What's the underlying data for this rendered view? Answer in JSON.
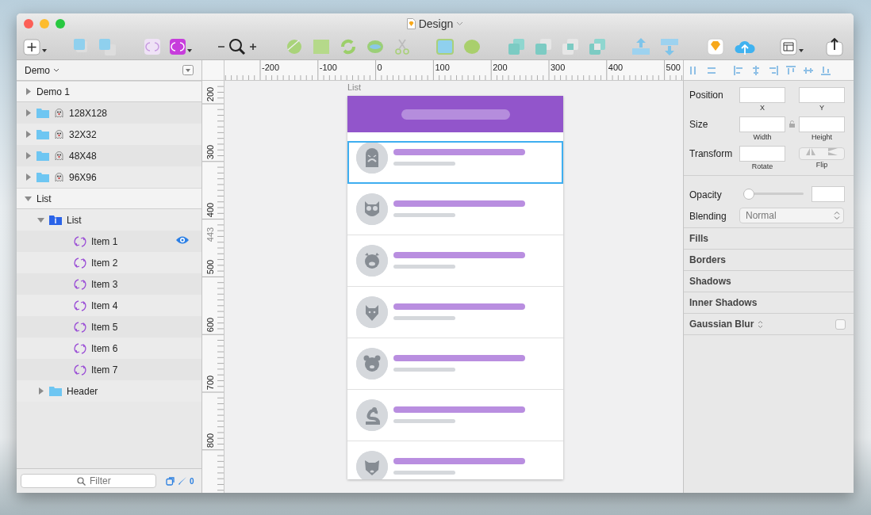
{
  "window": {
    "title": "Design"
  },
  "layers_panel": {
    "page": "Demo",
    "layers": [
      {
        "label": "Demo 1",
        "kind": "artboard",
        "expanded": false
      },
      {
        "label": "128X128",
        "kind": "symbol-folder",
        "expanded": false
      },
      {
        "label": "32X32",
        "kind": "symbol-folder",
        "expanded": false
      },
      {
        "label": "48X48",
        "kind": "symbol-folder",
        "expanded": false
      },
      {
        "label": "96X96",
        "kind": "symbol-folder",
        "expanded": false
      },
      {
        "label": "List",
        "kind": "artboard",
        "expanded": true,
        "children": [
          {
            "label": "List",
            "kind": "group",
            "expanded": true,
            "children": [
              {
                "label": "Item 1",
                "kind": "symbol",
                "hovered": true
              },
              {
                "label": "Item 2",
                "kind": "symbol",
                "hovered": false
              },
              {
                "label": "Item 3",
                "kind": "symbol",
                "hovered": false
              },
              {
                "label": "Item 4",
                "kind": "symbol",
                "hovered": false
              },
              {
                "label": "Item 5",
                "kind": "symbol",
                "hovered": false
              },
              {
                "label": "Item 6",
                "kind": "symbol",
                "hovered": false
              },
              {
                "label": "Item 7",
                "kind": "symbol",
                "hovered": false
              }
            ]
          },
          {
            "label": "Header",
            "kind": "folder",
            "expanded": false
          }
        ]
      }
    ],
    "filter": {
      "placeholder": "Filter"
    },
    "count": "0"
  },
  "rulers": {
    "horizontal": [
      "-200",
      "-100",
      "0",
      "100",
      "200",
      "300",
      "400",
      "500"
    ],
    "vertical": [
      "200",
      "300",
      "400",
      "500",
      "600",
      "700",
      "800"
    ],
    "guide": "443"
  },
  "canvas": {
    "artboard": {
      "title": "List",
      "rows": [
        {
          "kind": "ghost",
          "selected": true
        },
        {
          "kind": "owl",
          "selected": false
        },
        {
          "kind": "pig",
          "selected": false
        },
        {
          "kind": "cat",
          "selected": false
        },
        {
          "kind": "bear",
          "selected": false
        },
        {
          "kind": "snake",
          "selected": false
        },
        {
          "kind": "dog",
          "selected": false
        }
      ]
    }
  },
  "inspector": {
    "position": {
      "label": "Position",
      "x": "X",
      "y": "Y"
    },
    "size": {
      "label": "Size",
      "width": "Width",
      "height": "Height"
    },
    "transform": {
      "label": "Transform",
      "rotate": "Rotate",
      "flip": "Flip"
    },
    "opacity": {
      "label": "Opacity",
      "level": 0
    },
    "blending": {
      "label": "Blending",
      "value": "Normal"
    },
    "sections": [
      {
        "label": "Fills",
        "kind": "header"
      },
      {
        "label": "Borders",
        "kind": "header"
      },
      {
        "label": "Shadows",
        "kind": "header"
      },
      {
        "label": "Inner Shadows",
        "kind": "header"
      },
      {
        "label": "Gaussian Blur",
        "kind": "toggle",
        "checked": false
      }
    ]
  }
}
